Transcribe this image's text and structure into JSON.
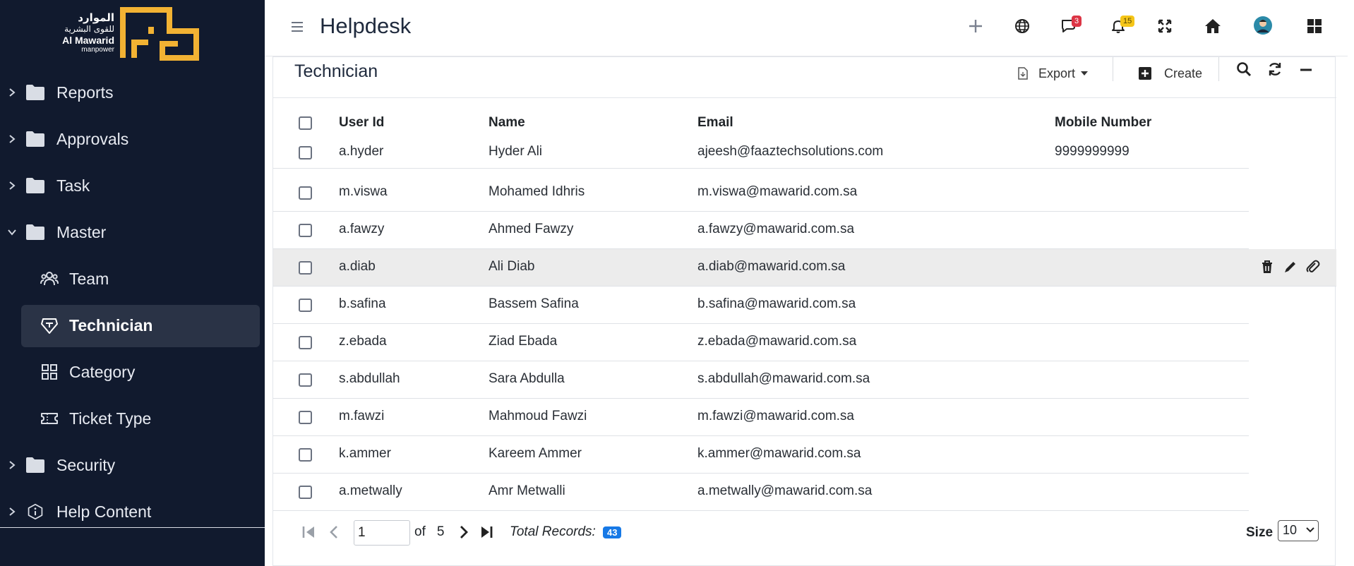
{
  "brand": {
    "arabic_line1": "الموارد",
    "arabic_line2": "للقوى البشرية",
    "english_name": "Al Mawarid",
    "english_sub": "manpower",
    "logo_color": "#f2b233"
  },
  "sidebar": {
    "items": [
      {
        "label": "Reports",
        "icon": "folder-icon",
        "expanded": false
      },
      {
        "label": "Approvals",
        "icon": "folder-icon",
        "expanded": false
      },
      {
        "label": "Task",
        "icon": "folder-icon",
        "expanded": false
      },
      {
        "label": "Master",
        "icon": "folder-icon",
        "expanded": true
      },
      {
        "label": "Security",
        "icon": "folder-icon",
        "expanded": false
      },
      {
        "label": "Help Content",
        "icon": "info-icon",
        "expanded": false
      }
    ],
    "master_children": [
      {
        "label": "Team",
        "icon": "team-icon",
        "active": false
      },
      {
        "label": "Technician",
        "icon": "technician-icon",
        "active": true
      },
      {
        "label": "Category",
        "icon": "category-icon",
        "active": false
      },
      {
        "label": "Ticket Type",
        "icon": "ticket-icon",
        "active": false
      }
    ],
    "background": "#111a2e",
    "active_background": "#2a3346"
  },
  "topbar": {
    "title": "Helpdesk",
    "messages_count": "3",
    "notifications_count": "15",
    "messages_badge_color": "#dc3545",
    "notifications_badge_color": "#f5c518"
  },
  "card": {
    "title": "Technician",
    "export_label": "Export",
    "create_label": "Create"
  },
  "table": {
    "columns": [
      "User Id",
      "Name",
      "Email",
      "Mobile Number"
    ],
    "rows": [
      {
        "user_id": "a.hyder",
        "name": "Hyder Ali",
        "email": "ajeesh@faaztechsolutions.com",
        "mobile": "9999999999"
      },
      {
        "user_id": "m.viswa",
        "name": "Mohamed Idhris",
        "email": "m.viswa@mawarid.com.sa",
        "mobile": ""
      },
      {
        "user_id": "a.fawzy",
        "name": "Ahmed Fawzy",
        "email": "a.fawzy@mawarid.com.sa",
        "mobile": ""
      },
      {
        "user_id": "a.diab",
        "name": "Ali Diab",
        "email": "a.diab@mawarid.com.sa",
        "mobile": ""
      },
      {
        "user_id": "b.safina",
        "name": "Bassem Safina",
        "email": "b.safina@mawarid.com.sa",
        "mobile": ""
      },
      {
        "user_id": "z.ebada",
        "name": "Ziad Ebada",
        "email": "z.ebada@mawarid.com.sa",
        "mobile": ""
      },
      {
        "user_id": "s.abdullah",
        "name": "Sara Abdulla",
        "email": "s.abdullah@mawarid.com.sa",
        "mobile": ""
      },
      {
        "user_id": "m.fawzi",
        "name": "Mahmoud Fawzi",
        "email": "m.fawzi@mawarid.com.sa",
        "mobile": ""
      },
      {
        "user_id": "k.ammer",
        "name": "Kareem Ammer",
        "email": "k.ammer@mawarid.com.sa",
        "mobile": ""
      },
      {
        "user_id": "a.metwally",
        "name": "Amr Metwalli",
        "email": "a.metwally@mawarid.com.sa",
        "mobile": ""
      }
    ],
    "hovered_row": 3
  },
  "pagination": {
    "current_page": "1",
    "of_label": "of",
    "total_pages": "5",
    "total_records_label": "Total Records:",
    "total_records": "43",
    "size_label": "Size",
    "size_value": "10"
  }
}
